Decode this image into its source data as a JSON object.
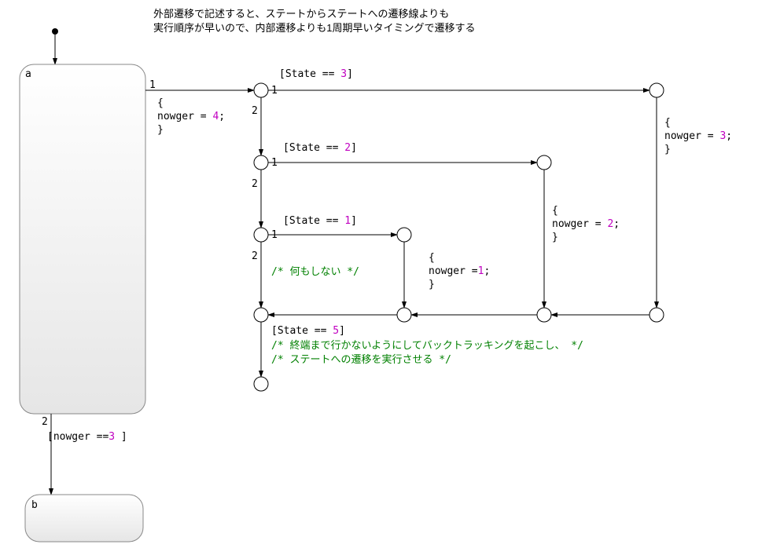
{
  "annotation": {
    "line1": "外部遷移で記述すると、ステートからステートへの遷移線よりも",
    "line2": "実行順序が早いので、内部遷移よりも1周期早いタイミングで遷移する"
  },
  "stateA": {
    "name": "a"
  },
  "stateB": {
    "name": "b"
  },
  "labels": {
    "exit1": "1",
    "exit2": "2",
    "j1_1": "1",
    "j1_2": "2",
    "j2_1": "1",
    "j2_2": "2",
    "j3_1": "1",
    "j3_2": "2"
  },
  "conditions": {
    "state3": "[State == ",
    "state3_num": "3",
    "state3_close": "]",
    "state2": "[State == ",
    "state2_num": "2",
    "state2_close": "]",
    "state1": "[State == ",
    "state1_num": "1",
    "state1_close": "]",
    "state5": "[State == ",
    "state5_num": "5",
    "state5_close": "]",
    "nowger3": "[nowger ==",
    "nowger3_num": "3",
    "nowger3_close": " ]"
  },
  "actions": {
    "ng4_open": "{",
    "ng4_body": "nowger = ",
    "ng4_num": "4",
    "ng4_semi": ";",
    "ng4_close": "}",
    "ng3_open": "{",
    "ng3_body": "nowger = ",
    "ng3_num": "3",
    "ng3_semi": ";",
    "ng3_close": "}",
    "ng2_open": "{",
    "ng2_body": "nowger = ",
    "ng2_num": "2",
    "ng2_semi": ";",
    "ng2_close": "}",
    "ng1_open": "{",
    "ng1_body": "nowger =",
    "ng1_num": "1",
    "ng1_semi": ";",
    "ng1_close": "}",
    "comment_none": "/* 何もしない */",
    "comment_bt1": "/* 終端まで行かないようにしてバックトラッキングを起こし、 */",
    "comment_bt2": "/* ステートへの遷移を実行させる */"
  }
}
